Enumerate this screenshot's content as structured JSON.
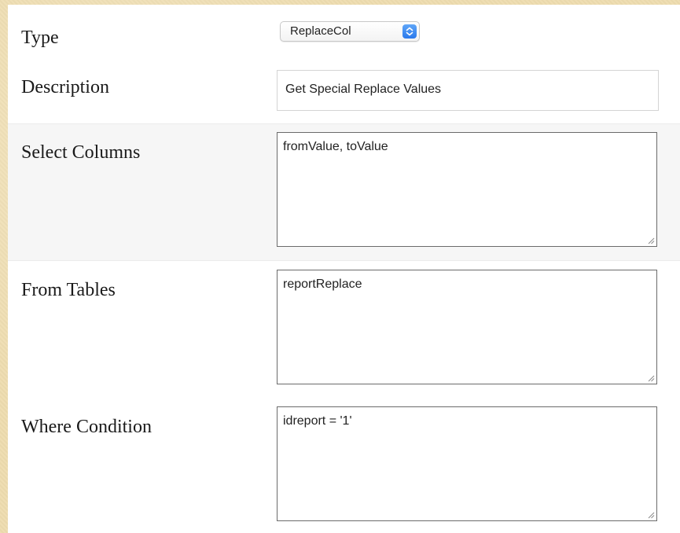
{
  "form": {
    "type": {
      "label": "Type",
      "selected": "ReplaceCol"
    },
    "description": {
      "label": "Description",
      "value": "Get Special Replace Values"
    },
    "select_columns": {
      "label": "Select Columns",
      "value": "fromValue, toValue"
    },
    "from_tables": {
      "label": "From Tables",
      "value": "reportReplace"
    },
    "where_condition": {
      "label": "Where Condition",
      "value": "idreport = '1'"
    }
  },
  "colors": {
    "background": "#eedcae",
    "panel": "#ffffff",
    "shaded_row": "#f6f6f6",
    "select_accent": "#2a79ec"
  }
}
